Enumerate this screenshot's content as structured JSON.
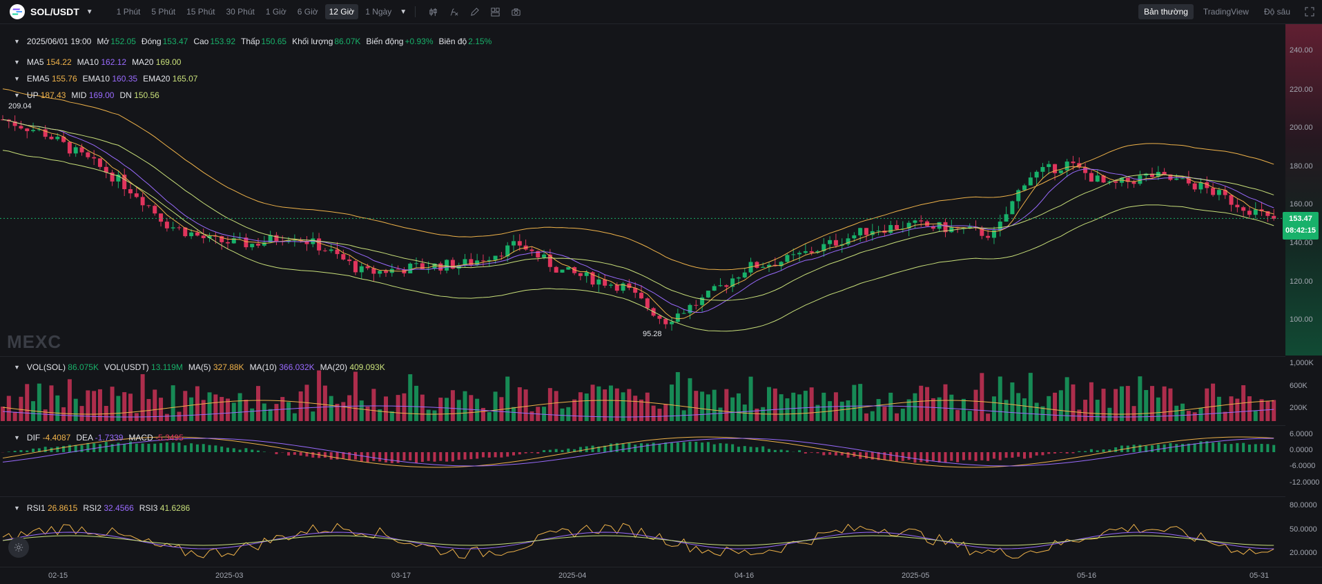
{
  "app": {
    "pair": "SOL/USDT",
    "timeframes": [
      "1 Phút",
      "5 Phút",
      "15 Phút",
      "30 Phút",
      "1 Giờ",
      "6 Giờ",
      "12 Giờ",
      "1 Ngày"
    ],
    "active_timeframe": "12 Giờ",
    "modes": [
      "Bản thường",
      "TradingView",
      "Độ sâu"
    ],
    "active_mode": "Bản thường",
    "watermark": "MEXC"
  },
  "ohlc": {
    "date": "2025/06/01 19:00",
    "open_label": "Mở",
    "open": "152.05",
    "close_label": "Đóng",
    "close": "153.47",
    "high_label": "Cao",
    "high": "153.92",
    "low_label": "Thấp",
    "low": "150.65",
    "vol_label": "Khối lượng",
    "vol": "86.07K",
    "change_label": "Biến động",
    "change": "+0.93%",
    "amp_label": "Biên độ",
    "amp": "2.15%"
  },
  "ma": {
    "ma5_label": "MA5",
    "ma5": "154.22",
    "ma10_label": "MA10",
    "ma10": "162.12",
    "ma20_label": "MA20",
    "ma20": "169.00"
  },
  "ema": {
    "ema5_label": "EMA5",
    "ema5": "155.76",
    "ema10_label": "EMA10",
    "ema10": "160.35",
    "ema20_label": "EMA20",
    "ema20": "165.07"
  },
  "boll": {
    "up_label": "UP",
    "up": "187.43",
    "mid_label": "MID",
    "mid": "169.00",
    "dn_label": "DN",
    "dn": "150.56"
  },
  "volume": {
    "vol_sol_label": "VOL(SOL)",
    "vol_sol": "86.075K",
    "vol_usdt_label": "VOL(USDT)",
    "vol_usdt": "13.119M",
    "ma5_label": "MA(5)",
    "ma5": "327.88K",
    "ma10_label": "MA(10)",
    "ma10": "366.032K",
    "ma20_label": "MA(20)",
    "ma20": "409.093K"
  },
  "macd": {
    "dif_label": "DIF",
    "dif": "-4.4087",
    "dea_label": "DEA",
    "dea": "-1.7339",
    "macd_label": "MACD",
    "macd": "-5.3495"
  },
  "rsi": {
    "rsi1_label": "RSI1",
    "rsi1": "26.8615",
    "rsi2_label": "RSI2",
    "rsi2": "32.4566",
    "rsi3_label": "RSI3",
    "rsi3": "41.6286"
  },
  "price_axis": [
    "240.00",
    "220.00",
    "200.00",
    "180.00",
    "160.00",
    "140.00",
    "120.00",
    "100.00"
  ],
  "vol_axis": [
    "1,000K",
    "600K",
    "200K"
  ],
  "macd_axis": [
    "6.0000",
    "0.0000",
    "-6.0000",
    "-12.0000"
  ],
  "rsi_axis": [
    "80.0000",
    "50.0000",
    "20.0000"
  ],
  "x_axis": [
    "02-15",
    "2025-03",
    "03-17",
    "2025-04",
    "04-16",
    "2025-05",
    "05-16",
    "05-31"
  ],
  "last_price": "153.47",
  "countdown": "08:42:15",
  "high_marker": "209.04",
  "low_marker": "95.28",
  "colors": {
    "up": "#18b16a",
    "down": "#e0355d",
    "ma5": "#f0b34a",
    "ma10": "#9a6bff",
    "ma20": "#c9e07a",
    "bg": "#141519"
  }
}
